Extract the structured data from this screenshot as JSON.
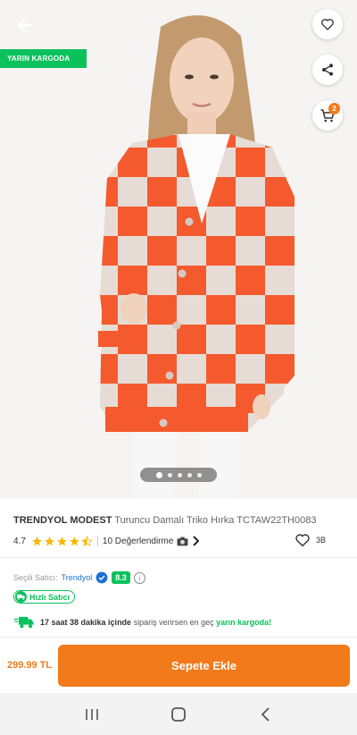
{
  "hero": {
    "badge": "YARIN KARGODA",
    "cart_count": "2",
    "image_count": 5,
    "active_image": 1
  },
  "product": {
    "brand": "TRENDYOL MODEST",
    "name": "Turuncu Damalı Triko Hırka TCTAW22TH0083",
    "rating": "4.7",
    "rating_value": 4.7,
    "reviews": "10 Değerlendirme",
    "favorites": "3B"
  },
  "seller": {
    "label": "Seçili Satıcı:",
    "name": "Trendyol",
    "score": "8.3",
    "fast_label": "Hızlı Satıcı"
  },
  "delivery": {
    "time": "17 saat 38 dakika içinde",
    "middle": "sipariş verirsen en geç",
    "highlight": "yarın kargoda!"
  },
  "bottom": {
    "price": "299.99 TL",
    "cta": "Sepete Ekle"
  },
  "colors": {
    "accent": "#f27a1a",
    "green": "#0bc15c",
    "link": "#1b6fd6"
  }
}
